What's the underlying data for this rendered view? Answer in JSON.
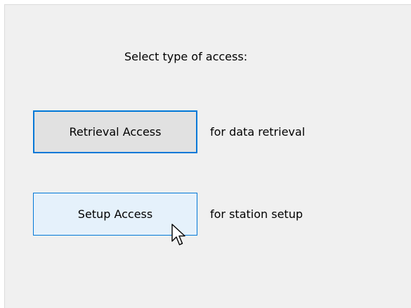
{
  "dialog": {
    "prompt": "Select type of access:",
    "options": [
      {
        "button_label": "Retrieval Access",
        "description": "for data retrieval"
      },
      {
        "button_label": "Setup Access",
        "description": "for station setup"
      }
    ]
  },
  "cursor": {
    "icon": "arrow-pointer-icon"
  },
  "colors": {
    "panel_background": "#f0f0f0",
    "focus_border": "#0078d7",
    "button_default": "#e1e1e1",
    "button_hover": "#e5f1fb"
  }
}
